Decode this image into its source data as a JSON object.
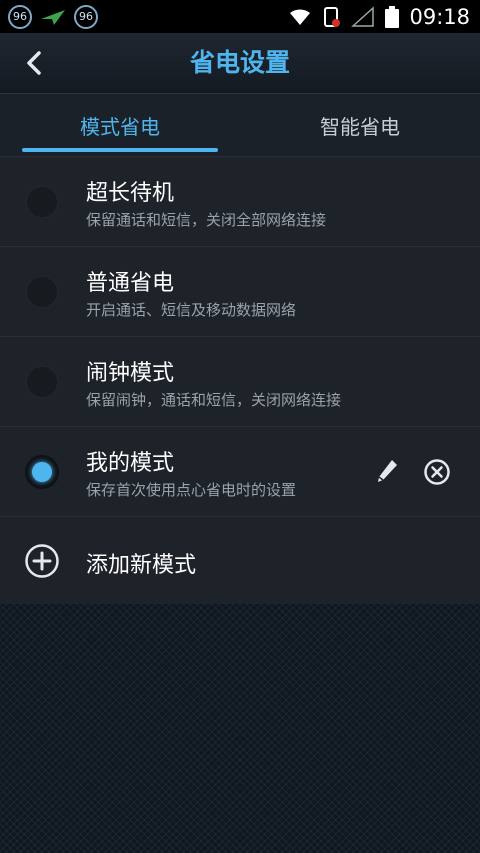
{
  "status_bar": {
    "badge1": "96",
    "badge2": "96",
    "time": "09:18",
    "icons": [
      "wifi-icon",
      "battery-alert-icon",
      "signal-icon",
      "battery-icon"
    ]
  },
  "header": {
    "title": "省电设置",
    "accent": "#4fb5ee"
  },
  "tabs": [
    {
      "label": "模式省电",
      "active": true
    },
    {
      "label": "智能省电",
      "active": false
    }
  ],
  "modes": [
    {
      "title": "超长待机",
      "subtitle": "保留通话和短信，关闭全部网络连接",
      "selected": false
    },
    {
      "title": "普通省电",
      "subtitle": "开启通话、短信及移动数据网络",
      "selected": false
    },
    {
      "title": "闹钟模式",
      "subtitle": "保留闹钟，通话和短信，关闭网络连接",
      "selected": false
    },
    {
      "title": "我的模式",
      "subtitle": "保存首次使用点心省电时的设置",
      "selected": true
    }
  ],
  "add_mode": {
    "label": "添加新模式"
  }
}
